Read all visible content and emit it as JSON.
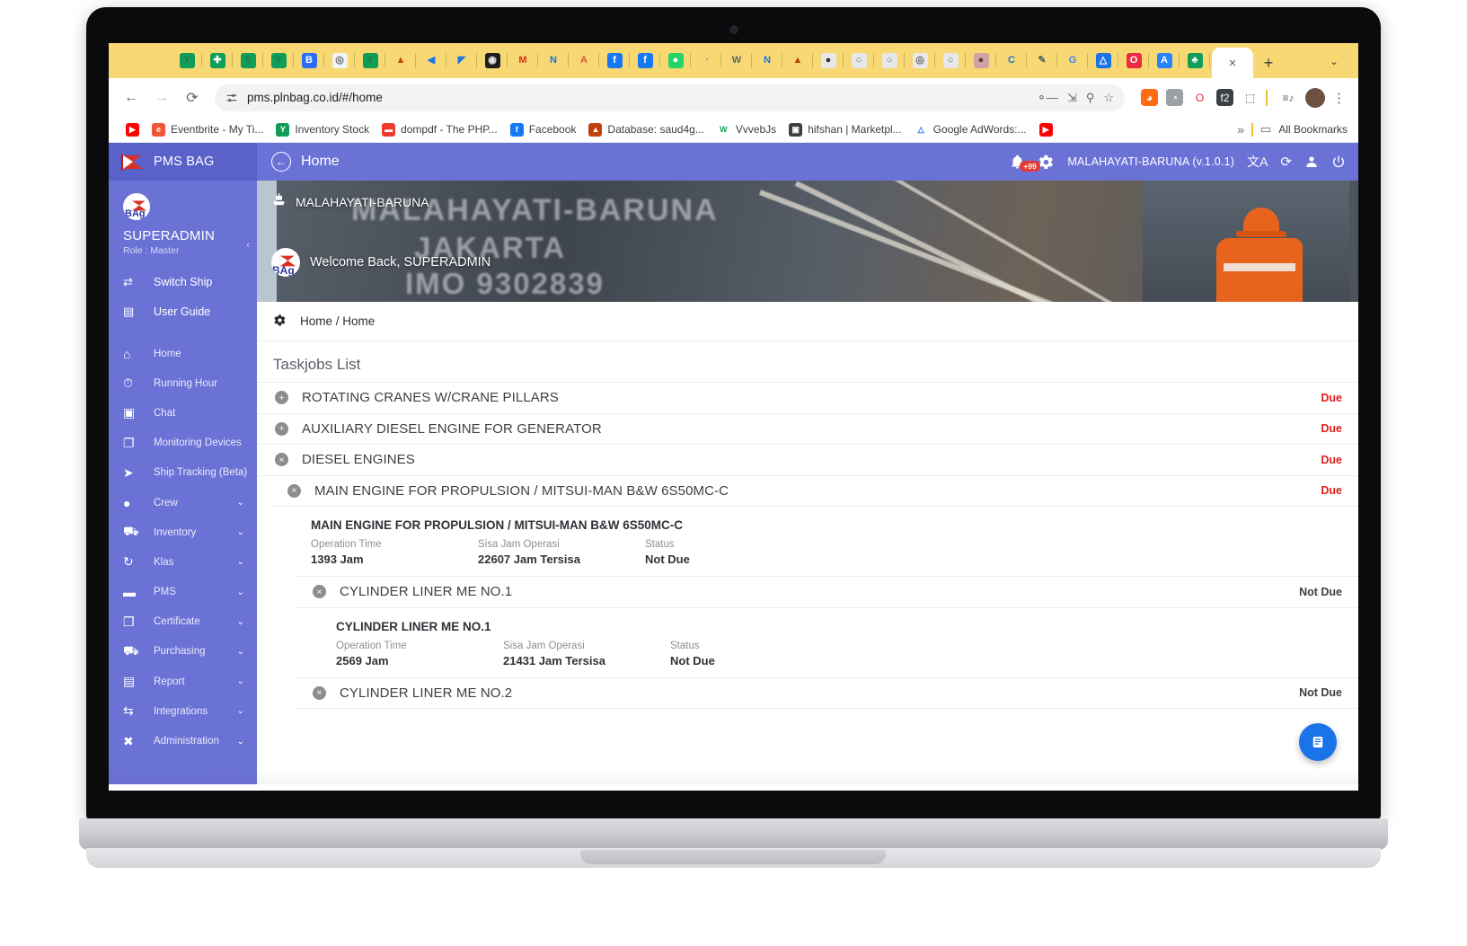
{
  "browser": {
    "url": "pms.plnbag.co.id/#/home",
    "omnibox_icon": "site-settings-icon",
    "nav": {
      "back": "←",
      "forward": "→",
      "reload": "⟳"
    },
    "tab_icons": [
      {
        "name": "yt-shorts-icon",
        "glyph": "Y",
        "bg": "#0f9d58",
        "color": "#1d7a45"
      },
      {
        "name": "sheets-icon",
        "glyph": "✚",
        "bg": "#0f9d58",
        "color": "#ffffff"
      },
      {
        "name": "yt-shorts-icon-2",
        "glyph": "Y",
        "bg": "#0f9d58",
        "color": "#1d7a45"
      },
      {
        "name": "yt-shorts-icon-3",
        "glyph": "Y",
        "bg": "#0f9d58",
        "color": "#1d7a45"
      },
      {
        "name": "bootstrap-icon",
        "glyph": "B",
        "bg": "#2d6cf6",
        "color": "#ffffff"
      },
      {
        "name": "fingerprint-icon",
        "glyph": "◎",
        "bg": "#f1f3f4",
        "color": "#5f6368"
      },
      {
        "name": "yt-shorts-icon-4",
        "glyph": "Y",
        "bg": "#0f9d58",
        "color": "#1d7a45"
      },
      {
        "name": "pma-icon",
        "glyph": "▲",
        "bg": "#f7d872",
        "color": "#c2410c"
      },
      {
        "name": "speaker-icon",
        "glyph": "◀",
        "bg": "#f7d872",
        "color": "#1a73e8"
      },
      {
        "name": "sail-icon",
        "glyph": "◤",
        "bg": "#f7d872",
        "color": "#1a73e8"
      },
      {
        "name": "dark-circle-icon",
        "glyph": "◉",
        "bg": "#1d1d1d",
        "color": "#e8e8e8"
      },
      {
        "name": "gmail-icon",
        "glyph": "M",
        "bg": "#f7d872",
        "color": "#d93025"
      },
      {
        "name": "nuxt-icon",
        "glyph": "N",
        "bg": "#f7d872",
        "color": "#1a73e8"
      },
      {
        "name": "adobe-icon",
        "glyph": "A",
        "bg": "#f7d872",
        "color": "#d6543a"
      },
      {
        "name": "facebook-icon",
        "glyph": "f",
        "bg": "#1877f2",
        "color": "#ffffff"
      },
      {
        "name": "facebook-icon-2",
        "glyph": "f",
        "bg": "#1877f2",
        "color": "#ffffff"
      },
      {
        "name": "whatsapp-icon",
        "glyph": "●",
        "bg": "#25d366",
        "color": "#ffffff"
      },
      {
        "name": "clock-icon",
        "glyph": "◔",
        "bg": "#f7d872",
        "color": "#9aa0a6"
      },
      {
        "name": "w-icon",
        "glyph": "W",
        "bg": "#f7d872",
        "color": "#5f6368"
      },
      {
        "name": "nuxt-icon-2",
        "glyph": "N",
        "bg": "#f7d872",
        "color": "#1a73e8"
      },
      {
        "name": "pma-icon-2",
        "glyph": "▲",
        "bg": "#f7d872",
        "color": "#c2410c"
      },
      {
        "name": "panda-icon",
        "glyph": "●",
        "bg": "#e8e8e8",
        "color": "#333333"
      },
      {
        "name": "circle-icon-1",
        "glyph": "○",
        "bg": "#e8e8e8",
        "color": "#5f6368"
      },
      {
        "name": "circle-icon-2",
        "glyph": "○",
        "bg": "#e8e8e8",
        "color": "#5f6368"
      },
      {
        "name": "circle-icon-3",
        "glyph": "◎",
        "bg": "#e8e8e8",
        "color": "#5f6368"
      },
      {
        "name": "circle-icon-4",
        "glyph": "○",
        "bg": "#e8e8e8",
        "color": "#5f6368"
      },
      {
        "name": "koala-icon",
        "glyph": "●",
        "bg": "#cfa3a3",
        "color": "#5d3a3a"
      },
      {
        "name": "c-icon",
        "glyph": "C",
        "bg": "#f7d872",
        "color": "#1a73e8"
      },
      {
        "name": "pen-icon",
        "glyph": "✎",
        "bg": "#f7d872",
        "color": "#5f6368"
      },
      {
        "name": "google-icon",
        "glyph": "G",
        "bg": "#f7d872",
        "color": "#4285f4"
      },
      {
        "name": "drive-icon",
        "glyph": "△",
        "bg": "#1a73e8",
        "color": "#ffffff"
      },
      {
        "name": "opera-icon",
        "glyph": "O",
        "bg": "#ee2b41",
        "color": "#ffffff"
      },
      {
        "name": "atlassian-icon",
        "glyph": "A",
        "bg": "#2684ff",
        "color": "#ffffff"
      },
      {
        "name": "leaf-icon",
        "glyph": "♣",
        "bg": "#0f9d58",
        "color": "#ffffff"
      }
    ],
    "active_tab_close": "×",
    "new_tab": "+",
    "tabstrip_chevron": "⌄",
    "extensions": [
      {
        "name": "extension-orange-icon",
        "glyph": "◕",
        "bg": "#ff6a13",
        "color": "#ffffff"
      },
      {
        "name": "extension-gray-icon",
        "glyph": "◔",
        "bg": "#9aa0a6",
        "color": "#ffffff"
      },
      {
        "name": "opera-vpn-icon",
        "glyph": "O",
        "bg": "#ffffff",
        "color": "#ee2b41"
      },
      {
        "name": "fontface-icon",
        "glyph": "f2",
        "bg": "#3c4043",
        "color": "#ffffff"
      },
      {
        "name": "puzzle-icon",
        "glyph": "⬚",
        "bg": "#ffffff",
        "color": "#3c4043"
      }
    ],
    "media_icon": "≡♪",
    "profile_initial": "●",
    "menu_icon": "⋮",
    "omnibox_actions": [
      "⊘",
      "↗",
      "⚲",
      "☆"
    ],
    "bookmarks": [
      {
        "name": "youtube",
        "label": "",
        "glyph": "▶",
        "bg": "#ff0000",
        "color": "#ffffff"
      },
      {
        "name": "eventbrite",
        "label": "Eventbrite - My Ti...",
        "glyph": "e",
        "bg": "#f05537",
        "color": "#ffffff"
      },
      {
        "name": "inventory-stock",
        "label": "Inventory Stock",
        "glyph": "Y",
        "bg": "#0f9d58",
        "color": "#ffffff"
      },
      {
        "name": "dompdf",
        "label": "dompdf - The PHP...",
        "glyph": "▬",
        "bg": "#ee3b2b",
        "color": "#ffffff"
      },
      {
        "name": "facebook",
        "label": "Facebook",
        "glyph": "f",
        "bg": "#1877f2",
        "color": "#ffffff"
      },
      {
        "name": "database-saud4g",
        "label": "Database: saud4g...",
        "glyph": "▲",
        "bg": "#c2410c",
        "color": "#ffffff"
      },
      {
        "name": "vvvebjs",
        "label": "VvvebJs",
        "glyph": "W",
        "bg": "#ffffff",
        "color": "#0f9d58"
      },
      {
        "name": "hifshan-marketplace",
        "label": "hifshan | Marketpl...",
        "glyph": "▣",
        "bg": "#3c4043",
        "color": "#ffffff"
      },
      {
        "name": "google-adwords",
        "label": "Google AdWords:...",
        "glyph": "△",
        "bg": "#ffffff",
        "color": "#1a73e8"
      },
      {
        "name": "youtube-2",
        "label": "",
        "glyph": "▶",
        "bg": "#ff0000",
        "color": "#ffffff"
      }
    ],
    "overflow": "»",
    "all_bookmarks": "All Bookmarks",
    "folder_icon": "▭"
  },
  "sidebar": {
    "brand": "PMS BAG",
    "user": "SUPERADMIN",
    "role": "Role : Master",
    "collapse_icon": "‹",
    "quicklinks": [
      {
        "name": "switch-ship",
        "label": "Switch Ship",
        "icon": "⇄"
      },
      {
        "name": "user-guide",
        "label": "User Guide",
        "icon": "▤"
      }
    ],
    "menu": [
      {
        "name": "home",
        "label": "Home",
        "icon": "⌂",
        "chev": ""
      },
      {
        "name": "running-hour",
        "label": "Running Hour",
        "icon": "⏱",
        "chev": ""
      },
      {
        "name": "chat",
        "label": "Chat",
        "icon": "▣",
        "chev": ""
      },
      {
        "name": "monitoring-devices",
        "label": "Monitoring Devices",
        "icon": "❐",
        "chev": ""
      },
      {
        "name": "ship-tracking",
        "label": "Ship Tracking (Beta)",
        "icon": "➤",
        "chev": ""
      },
      {
        "name": "crew",
        "label": "Crew",
        "icon": "●",
        "chev": "⌄"
      },
      {
        "name": "inventory",
        "label": "Inventory",
        "icon": "⛟",
        "chev": "⌄"
      },
      {
        "name": "klas",
        "label": "Klas",
        "icon": "↻",
        "chev": "⌄"
      },
      {
        "name": "pms",
        "label": "PMS",
        "icon": "▬",
        "chev": "⌄"
      },
      {
        "name": "certificate",
        "label": "Certificate",
        "icon": "❒",
        "chev": "⌄"
      },
      {
        "name": "purchasing",
        "label": "Purchasing",
        "icon": "⛟",
        "chev": "⌄"
      },
      {
        "name": "report",
        "label": "Report",
        "icon": "▤",
        "chev": "⌄"
      },
      {
        "name": "integrations",
        "label": "Integrations",
        "icon": "⇆",
        "chev": "⌄"
      },
      {
        "name": "administration",
        "label": "Administration",
        "icon": "✖",
        "chev": "⌄"
      }
    ]
  },
  "topbar": {
    "back_icon": "←",
    "title": "Home",
    "bell_icon": "🔔",
    "notification_badge": "+99",
    "gear_icon": "⚙",
    "ship_version": "MALAHAYATI-BARUNA (v.1.0.1)",
    "translate_icon": "文A",
    "refresh_icon": "⟳",
    "user_icon": "●",
    "power_icon": "⏻"
  },
  "hero": {
    "ship_icon": "⛴",
    "ship_name": "MALAHAYATI-BARUNA",
    "welcome": "Welcome Back, SUPERADMIN",
    "avatar_text": "BAg",
    "bg_line1": "MALAHAYATI-BARUNA",
    "bg_line2": "JAKARTA",
    "bg_line3": "IMO 9302839"
  },
  "breadcrumb": {
    "gear_icon": "⚙",
    "text": "Home / Home"
  },
  "main": {
    "section_title": "Taskjobs List",
    "jobs": [
      {
        "name": "ROTATING CRANES W/CRANE PILLARS",
        "toggle": "+",
        "toggle_name": "expand-icon",
        "status": "Due",
        "status_type": "due"
      },
      {
        "name": "AUXILIARY DIESEL ENGINE FOR GENERATOR",
        "toggle": "+",
        "toggle_name": "expand-icon",
        "status": "Due",
        "status_type": "due"
      },
      {
        "name": "DIESEL ENGINES",
        "toggle": "×",
        "toggle_name": "collapse-icon",
        "status": "Due",
        "status_type": "due"
      }
    ],
    "sub_job": {
      "name": "MAIN ENGINE FOR PROPULSION / MITSUI-MAN B&W 6S50MC-C",
      "toggle": "×",
      "status": "Due",
      "status_type": "due",
      "detail": {
        "title": "MAIN ENGINE FOR PROPULSION / MITSUI-MAN B&W 6S50MC-C",
        "labels": [
          "Operation Time",
          "Sisa Jam Operasi",
          "Status"
        ],
        "values": [
          "1393 Jam",
          "22607 Jam Tersisa",
          "Not Due"
        ]
      }
    },
    "sub_sub_jobs": [
      {
        "name": "CYLINDER LINER ME NO.1",
        "toggle": "×",
        "status": "Not Due",
        "status_type": "notdue",
        "detail": {
          "title": "CYLINDER LINER ME NO.1",
          "labels": [
            "Operation Time",
            "Sisa Jam Operasi",
            "Status"
          ],
          "values": [
            "2569 Jam",
            "21431 Jam Tersisa",
            "Not Due"
          ]
        }
      },
      {
        "name": "CYLINDER LINER ME NO.2",
        "toggle": "×",
        "status": "Not Due",
        "status_type": "notdue"
      }
    ],
    "chat_fab_icon": "⬜"
  },
  "colors": {
    "accent": "#6b72d6",
    "brand_dark": "#5a61c9",
    "due": "#e02020",
    "tabstrip": "#f7d872"
  }
}
